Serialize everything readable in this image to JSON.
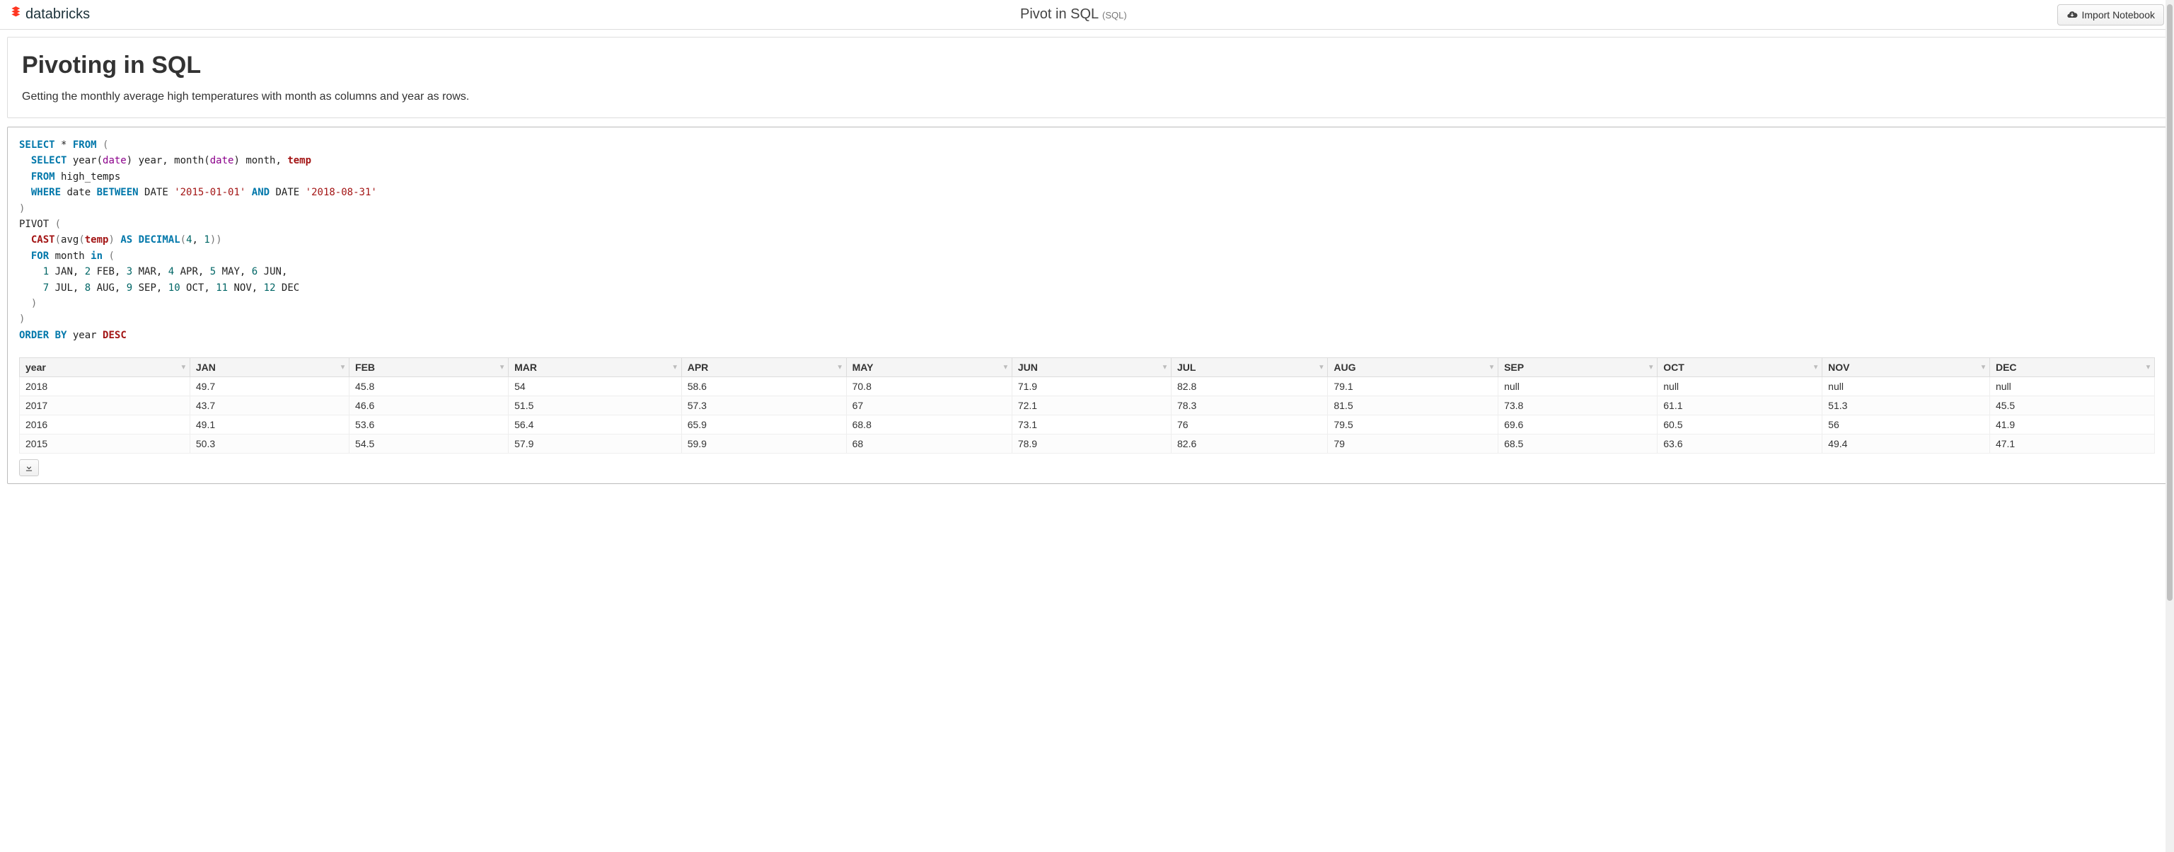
{
  "header": {
    "logo_text": "databricks",
    "title": "Pivot in SQL",
    "title_lang": "(SQL)",
    "import_label": "Import Notebook"
  },
  "markdown": {
    "h1": "Pivoting in SQL",
    "p": "Getting the monthly average high temperatures with month as columns and year as rows."
  },
  "sql": {
    "tokens": [
      {
        "t": "SELECT",
        "c": "kw"
      },
      {
        "t": " * ",
        "c": ""
      },
      {
        "t": "FROM",
        "c": "kw"
      },
      {
        "t": " (",
        "c": "paren"
      },
      {
        "t": "\n  ",
        "c": ""
      },
      {
        "t": "SELECT",
        "c": "kw"
      },
      {
        "t": " year(",
        "c": ""
      },
      {
        "t": "date",
        "c": "fn"
      },
      {
        "t": ") year, month(",
        "c": ""
      },
      {
        "t": "date",
        "c": "fn"
      },
      {
        "t": ") month, ",
        "c": ""
      },
      {
        "t": "temp",
        "c": "id"
      },
      {
        "t": "\n  ",
        "c": ""
      },
      {
        "t": "FROM",
        "c": "kw"
      },
      {
        "t": " high_temps\n  ",
        "c": ""
      },
      {
        "t": "WHERE",
        "c": "kw"
      },
      {
        "t": " date ",
        "c": ""
      },
      {
        "t": "BETWEEN",
        "c": "kw"
      },
      {
        "t": " DATE ",
        "c": ""
      },
      {
        "t": "'2015-01-01'",
        "c": "str"
      },
      {
        "t": " ",
        "c": ""
      },
      {
        "t": "AND",
        "c": "kw"
      },
      {
        "t": " DATE ",
        "c": ""
      },
      {
        "t": "'2018-08-31'",
        "c": "str"
      },
      {
        "t": "\n",
        "c": ""
      },
      {
        "t": ")",
        "c": "paren"
      },
      {
        "t": "\nPIVOT ",
        "c": ""
      },
      {
        "t": "(",
        "c": "paren"
      },
      {
        "t": "\n  ",
        "c": ""
      },
      {
        "t": "CAST",
        "c": "kw2"
      },
      {
        "t": "(",
        "c": "paren"
      },
      {
        "t": "avg",
        "c": ""
      },
      {
        "t": "(",
        "c": "paren"
      },
      {
        "t": "temp",
        "c": "id"
      },
      {
        "t": ")",
        "c": "paren"
      },
      {
        "t": " ",
        "c": ""
      },
      {
        "t": "AS",
        "c": "kw"
      },
      {
        "t": " ",
        "c": ""
      },
      {
        "t": "DECIMAL",
        "c": "kw"
      },
      {
        "t": "(",
        "c": "paren"
      },
      {
        "t": "4",
        "c": "num"
      },
      {
        "t": ", ",
        "c": ""
      },
      {
        "t": "1",
        "c": "num"
      },
      {
        "t": "))",
        "c": "paren"
      },
      {
        "t": "\n  ",
        "c": ""
      },
      {
        "t": "FOR",
        "c": "kw"
      },
      {
        "t": " month ",
        "c": ""
      },
      {
        "t": "in",
        "c": "kw"
      },
      {
        "t": " (",
        "c": "paren"
      },
      {
        "t": "\n    ",
        "c": ""
      },
      {
        "t": "1",
        "c": "num"
      },
      {
        "t": " JAN, ",
        "c": ""
      },
      {
        "t": "2",
        "c": "num"
      },
      {
        "t": " FEB, ",
        "c": ""
      },
      {
        "t": "3",
        "c": "num"
      },
      {
        "t": " MAR, ",
        "c": ""
      },
      {
        "t": "4",
        "c": "num"
      },
      {
        "t": " APR, ",
        "c": ""
      },
      {
        "t": "5",
        "c": "num"
      },
      {
        "t": " MAY, ",
        "c": ""
      },
      {
        "t": "6",
        "c": "num"
      },
      {
        "t": " JUN,\n    ",
        "c": ""
      },
      {
        "t": "7",
        "c": "num"
      },
      {
        "t": " JUL, ",
        "c": ""
      },
      {
        "t": "8",
        "c": "num"
      },
      {
        "t": " AUG, ",
        "c": ""
      },
      {
        "t": "9",
        "c": "num"
      },
      {
        "t": " SEP, ",
        "c": ""
      },
      {
        "t": "10",
        "c": "num"
      },
      {
        "t": " OCT, ",
        "c": ""
      },
      {
        "t": "11",
        "c": "num"
      },
      {
        "t": " NOV, ",
        "c": ""
      },
      {
        "t": "12",
        "c": "num"
      },
      {
        "t": " DEC\n  ",
        "c": ""
      },
      {
        "t": ")",
        "c": "paren"
      },
      {
        "t": "\n",
        "c": ""
      },
      {
        "t": ")",
        "c": "paren"
      },
      {
        "t": "\n",
        "c": ""
      },
      {
        "t": "ORDER",
        "c": "kw"
      },
      {
        "t": " ",
        "c": ""
      },
      {
        "t": "BY",
        "c": "kw"
      },
      {
        "t": " year ",
        "c": ""
      },
      {
        "t": "DESC",
        "c": "kw2"
      }
    ]
  },
  "table": {
    "columns": [
      "year",
      "JAN",
      "FEB",
      "MAR",
      "APR",
      "MAY",
      "JUN",
      "JUL",
      "AUG",
      "SEP",
      "OCT",
      "NOV",
      "DEC"
    ],
    "rows": [
      [
        "2018",
        "49.7",
        "45.8",
        "54",
        "58.6",
        "70.8",
        "71.9",
        "82.8",
        "79.1",
        "null",
        "null",
        "null",
        "null"
      ],
      [
        "2017",
        "43.7",
        "46.6",
        "51.5",
        "57.3",
        "67",
        "72.1",
        "78.3",
        "81.5",
        "73.8",
        "61.1",
        "51.3",
        "45.5"
      ],
      [
        "2016",
        "49.1",
        "53.6",
        "56.4",
        "65.9",
        "68.8",
        "73.1",
        "76",
        "79.5",
        "69.6",
        "60.5",
        "56",
        "41.9"
      ],
      [
        "2015",
        "50.3",
        "54.5",
        "57.9",
        "59.9",
        "68",
        "78.9",
        "82.6",
        "79",
        "68.5",
        "63.6",
        "49.4",
        "47.1"
      ]
    ]
  }
}
